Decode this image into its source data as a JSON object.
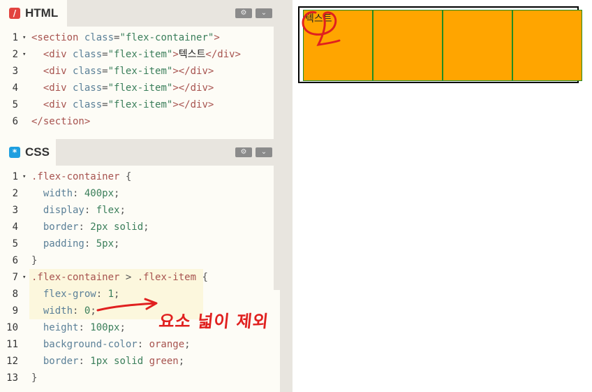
{
  "html_panel": {
    "title": "HTML",
    "icon_glyph": "/",
    "icon_color": "#e2433f",
    "settings_glyph": "⚙",
    "collapse_glyph": "⌄",
    "lines": [
      {
        "n": "1",
        "fold": "▾",
        "parts": [
          [
            "tag",
            "<section "
          ],
          [
            "attr",
            "class"
          ],
          [
            "punct",
            "="
          ],
          [
            "str",
            "\"flex-container\""
          ],
          [
            "tag",
            ">"
          ]
        ]
      },
      {
        "n": "2",
        "fold": "▾",
        "parts": [
          [
            "tag",
            "  <div "
          ],
          [
            "attr",
            "class"
          ],
          [
            "punct",
            "="
          ],
          [
            "str",
            "\"flex-item\""
          ],
          [
            "tag",
            ">"
          ],
          [
            "ktxt",
            "텍스트"
          ],
          [
            "tag",
            "</div>"
          ]
        ]
      },
      {
        "n": "3",
        "fold": "",
        "parts": [
          [
            "tag",
            "  <div "
          ],
          [
            "attr",
            "class"
          ],
          [
            "punct",
            "="
          ],
          [
            "str",
            "\"flex-item\""
          ],
          [
            "tag",
            "></div>"
          ]
        ]
      },
      {
        "n": "4",
        "fold": "",
        "parts": [
          [
            "tag",
            "  <div "
          ],
          [
            "attr",
            "class"
          ],
          [
            "punct",
            "="
          ],
          [
            "str",
            "\"flex-item\""
          ],
          [
            "tag",
            "></div>"
          ]
        ]
      },
      {
        "n": "5",
        "fold": "",
        "parts": [
          [
            "tag",
            "  <div "
          ],
          [
            "attr",
            "class"
          ],
          [
            "punct",
            "="
          ],
          [
            "str",
            "\"flex-item\""
          ],
          [
            "tag",
            "></div>"
          ]
        ]
      },
      {
        "n": "6",
        "fold": "",
        "parts": [
          [
            "tag",
            "</section>"
          ]
        ]
      }
    ]
  },
  "css_panel": {
    "title": "CSS",
    "icon_glyph": "*",
    "icon_color": "#1e9fe0",
    "settings_glyph": "⚙",
    "collapse_glyph": "⌄",
    "lines": [
      {
        "n": "1",
        "fold": "▾",
        "parts": [
          [
            "sel",
            ".flex-container"
          ],
          [
            "punct",
            " {"
          ]
        ]
      },
      {
        "n": "2",
        "fold": "",
        "parts": [
          [
            "prop",
            "  width"
          ],
          [
            "punct",
            ": "
          ],
          [
            "val",
            "400px"
          ],
          [
            "punct",
            ";"
          ]
        ]
      },
      {
        "n": "3",
        "fold": "",
        "parts": [
          [
            "prop",
            "  display"
          ],
          [
            "punct",
            ": "
          ],
          [
            "val",
            "flex"
          ],
          [
            "punct",
            ";"
          ]
        ]
      },
      {
        "n": "4",
        "fold": "",
        "parts": [
          [
            "prop",
            "  border"
          ],
          [
            "punct",
            ": "
          ],
          [
            "val",
            "2px solid"
          ],
          [
            "punct",
            ";"
          ]
        ]
      },
      {
        "n": "5",
        "fold": "",
        "parts": [
          [
            "prop",
            "  padding"
          ],
          [
            "punct",
            ": "
          ],
          [
            "val",
            "5px"
          ],
          [
            "punct",
            ";"
          ]
        ]
      },
      {
        "n": "6",
        "fold": "",
        "parts": [
          [
            "punct",
            "}"
          ]
        ]
      },
      {
        "n": "7",
        "fold": "▾",
        "hl": true,
        "parts": [
          [
            "sel",
            ".flex-container"
          ],
          [
            "punct",
            " > "
          ],
          [
            "sel",
            ".flex-item"
          ],
          [
            "punct",
            " {"
          ]
        ]
      },
      {
        "n": "8",
        "fold": "",
        "hl": true,
        "parts": [
          [
            "prop",
            "  flex-grow"
          ],
          [
            "punct",
            ": "
          ],
          [
            "val",
            "1"
          ],
          [
            "punct",
            ";"
          ]
        ]
      },
      {
        "n": "9",
        "fold": "",
        "hl": true,
        "parts": [
          [
            "prop",
            "  width"
          ],
          [
            "punct",
            ": "
          ],
          [
            "val",
            "0"
          ],
          [
            "punct",
            ";"
          ]
        ]
      },
      {
        "n": "10",
        "fold": "",
        "parts": [
          [
            "prop",
            "  height"
          ],
          [
            "punct",
            ": "
          ],
          [
            "val",
            "100px"
          ],
          [
            "punct",
            ";"
          ]
        ]
      },
      {
        "n": "11",
        "fold": "",
        "parts": [
          [
            "prop",
            "  background-color"
          ],
          [
            "punct",
            ": "
          ],
          [
            "sel",
            "orange"
          ],
          [
            "punct",
            ";"
          ]
        ]
      },
      {
        "n": "12",
        "fold": "",
        "parts": [
          [
            "prop",
            "  border"
          ],
          [
            "punct",
            ": "
          ],
          [
            "val",
            "1px solid "
          ],
          [
            "sel",
            "green"
          ],
          [
            "punct",
            ";"
          ]
        ]
      },
      {
        "n": "13",
        "fold": "",
        "parts": [
          [
            "punct",
            "}"
          ]
        ]
      }
    ]
  },
  "preview": {
    "item_texts": [
      "텍스트",
      "",
      "",
      ""
    ],
    "item_color": "#ffa500",
    "item_border": "#228b22"
  },
  "annotation": {
    "text": "요소 넓이 제외",
    "color": "#e0201f"
  }
}
